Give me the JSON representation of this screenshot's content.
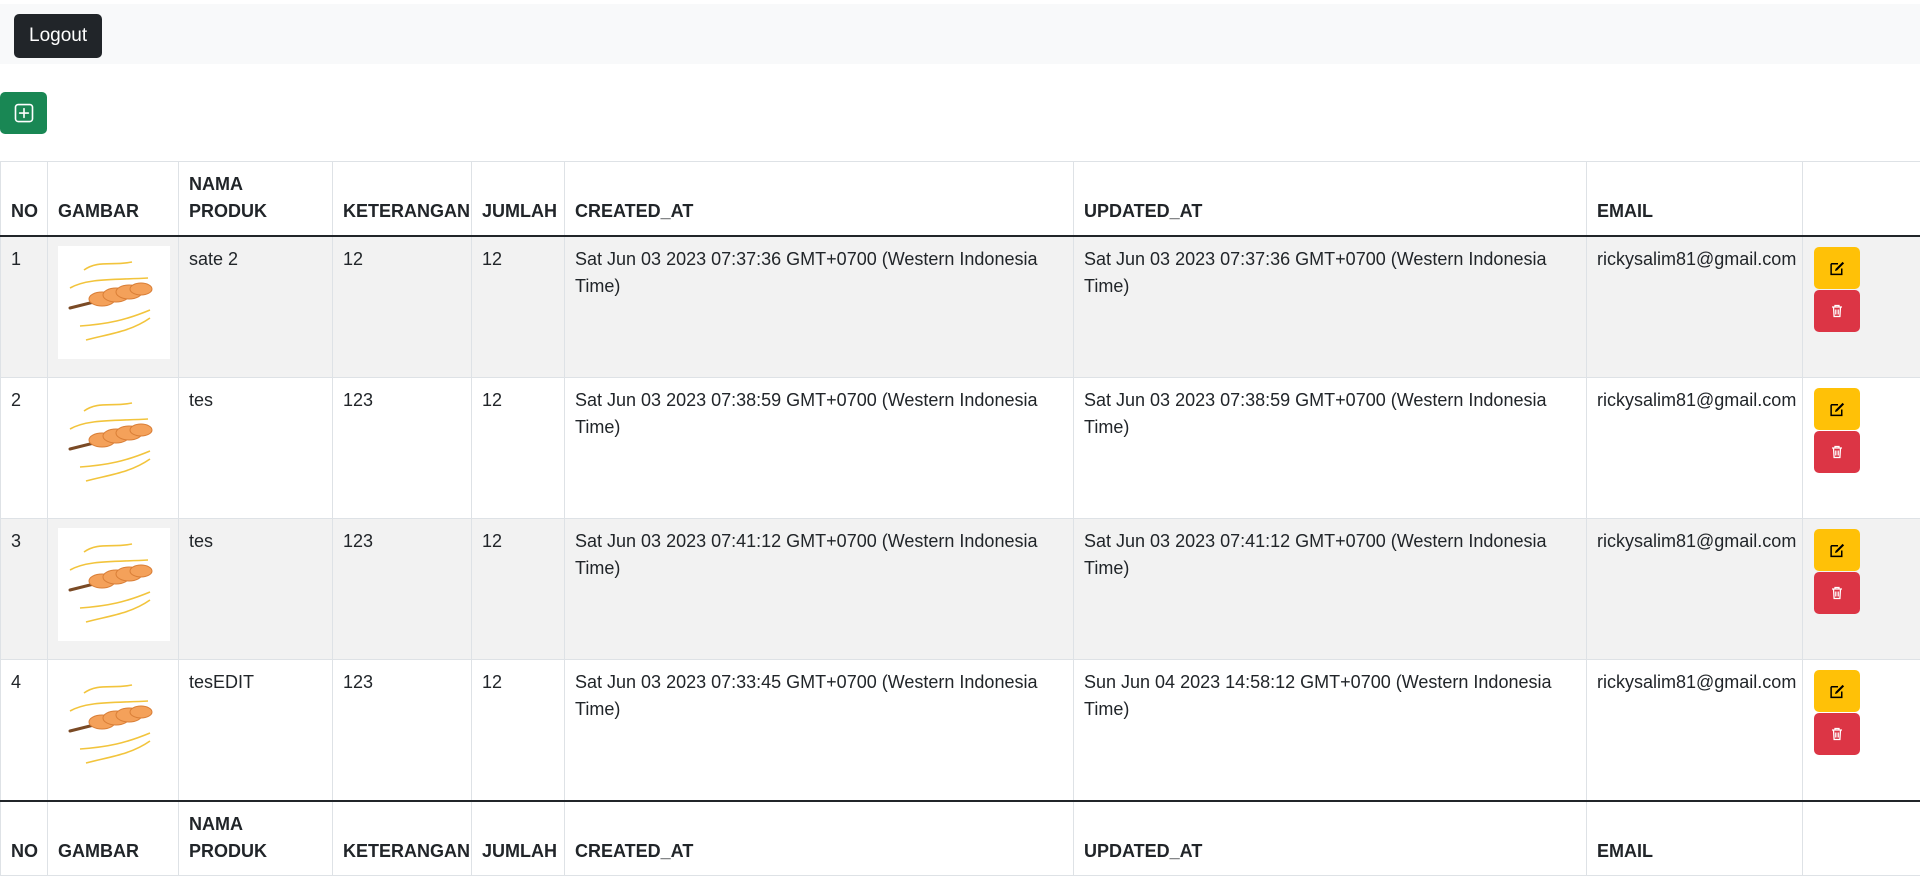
{
  "header": {
    "logout_label": "Logout"
  },
  "toolbar": {
    "add_icon": "plus-square-icon"
  },
  "table": {
    "columns": [
      "NO",
      "GAMBAR",
      "NAMA PRODUK",
      "KETERANGAN",
      "JUMLAH",
      "CREATED_AT",
      "UPDATED_AT",
      "EMAIL",
      ""
    ],
    "rows": [
      {
        "no": "1",
        "image": "satay-skewer-image",
        "name": "sate 2",
        "keterangan": "12",
        "jumlah": "12",
        "created_at": "Sat Jun 03 2023 07:37:36 GMT+0700 (Western Indonesia Time)",
        "updated_at": "Sat Jun 03 2023 07:37:36 GMT+0700 (Western Indonesia Time)",
        "email": "rickysalim81@gmail.com"
      },
      {
        "no": "2",
        "image": "satay-skewer-image",
        "name": "tes",
        "keterangan": "123",
        "jumlah": "12",
        "created_at": "Sat Jun 03 2023 07:38:59 GMT+0700 (Western Indonesia Time)",
        "updated_at": "Sat Jun 03 2023 07:38:59 GMT+0700 (Western Indonesia Time)",
        "email": "rickysalim81@gmail.com"
      },
      {
        "no": "3",
        "image": "satay-skewer-image",
        "name": "tes",
        "keterangan": "123",
        "jumlah": "12",
        "created_at": "Sat Jun 03 2023 07:41:12 GMT+0700 (Western Indonesia Time)",
        "updated_at": "Sat Jun 03 2023 07:41:12 GMT+0700 (Western Indonesia Time)",
        "email": "rickysalim81@gmail.com"
      },
      {
        "no": "4",
        "image": "satay-skewer-image",
        "name": "tesEDIT",
        "keterangan": "123",
        "jumlah": "12",
        "created_at": "Sat Jun 03 2023 07:33:45 GMT+0700 (Western Indonesia Time)",
        "updated_at": "Sun Jun 04 2023 14:58:12 GMT+0700 (Western Indonesia Time)",
        "email": "rickysalim81@gmail.com"
      }
    ],
    "actions": {
      "edit_icon": "edit-icon",
      "delete_icon": "trash-icon"
    }
  },
  "colors": {
    "topbar_bg": "#f8f9fa",
    "logout_btn": "#212529",
    "add_btn": "#198754",
    "edit_btn": "#ffc107",
    "delete_btn": "#dc3545",
    "striped_row": "#f2f2f2"
  }
}
